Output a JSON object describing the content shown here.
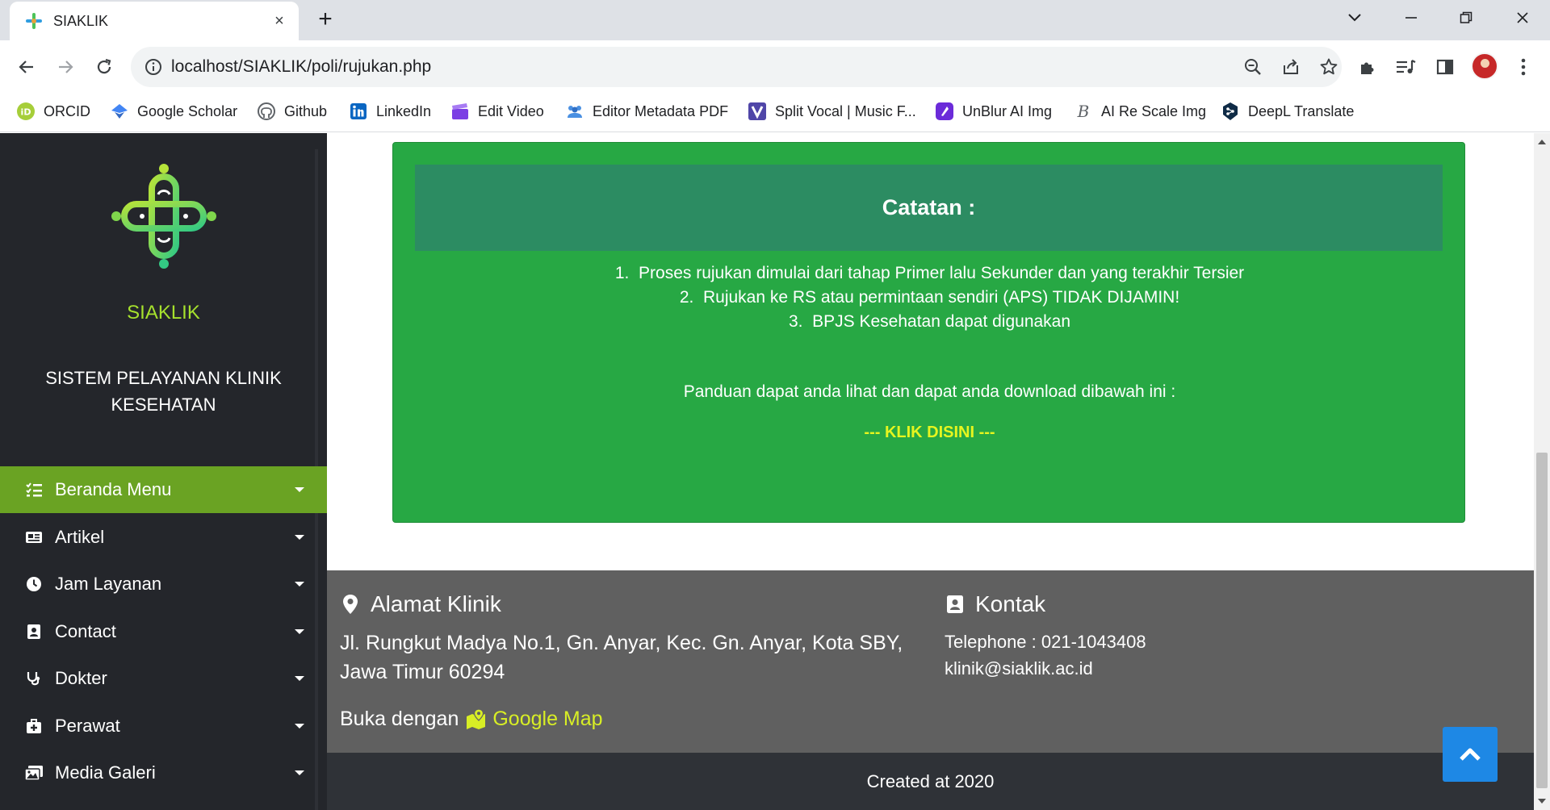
{
  "browser": {
    "tab_title": "SIAKLIK",
    "tab_close": "×",
    "new_tab": "+",
    "url": "localhost/SIAKLIK/poli/rujukan.php",
    "bookmarks": [
      {
        "label": "ORCID",
        "icon": "orcid-icon"
      },
      {
        "label": "Google Scholar",
        "icon": "google-scholar-icon"
      },
      {
        "label": "Github",
        "icon": "github-icon"
      },
      {
        "label": "LinkedIn",
        "icon": "linkedin-icon"
      },
      {
        "label": "Edit Video",
        "icon": "clapperboard-icon"
      },
      {
        "label": "Editor Metadata PDF",
        "icon": "users-icon"
      },
      {
        "label": "Split Vocal | Music F...",
        "icon": "v-logo-icon"
      },
      {
        "label": "UnBlur AI Img",
        "icon": "unblur-icon"
      },
      {
        "label": "AI Re Scale Img",
        "icon": "b-logo-icon"
      },
      {
        "label": "DeepL Translate",
        "icon": "deepl-icon"
      }
    ]
  },
  "sidebar": {
    "brand": "SIAKLIK",
    "subtitle": "SISTEM PELAYANAN KLINIK KESEHATAN",
    "menu": [
      {
        "label": "Beranda Menu",
        "icon": "list-icon",
        "active": true
      },
      {
        "label": "Artikel",
        "icon": "newspaper-icon",
        "active": false
      },
      {
        "label": "Jam Layanan",
        "icon": "clock-icon",
        "active": false
      },
      {
        "label": "Contact",
        "icon": "contact-card-icon",
        "active": false
      },
      {
        "label": "Dokter",
        "icon": "stethoscope-icon",
        "active": false
      },
      {
        "label": "Perawat",
        "icon": "medkit-icon",
        "active": false
      },
      {
        "label": "Media Galeri",
        "icon": "images-icon",
        "active": false
      }
    ]
  },
  "note": {
    "title": "Catatan :",
    "items": [
      "1.  Proses rujukan dimulai dari tahap Primer lalu Sekunder dan yang terakhir Tersier",
      "2.  Rujukan ke RS atau permintaan sendiri (APS) TIDAK DIJAMIN!",
      "3.  BPJS Kesehatan dapat digunakan"
    ],
    "guide": "Panduan dapat anda lihat dan dapat anda download dibawah ini :",
    "link": "--- KLIK DISINI ---"
  },
  "footer": {
    "address_heading": "Alamat Klinik",
    "address_line1": "Jl. Rungkut Madya No.1, Gn. Anyar, Kec. Gn. Anyar, Kota SBY,",
    "address_line2": "Jawa Timur 60294",
    "open_with": "Buka dengan",
    "map_link": "Google Map",
    "contact_heading": "Kontak",
    "telephone": "Telephone : 021-1043408",
    "email": "klinik@siaklik.ac.id",
    "copyright": "Created at 2020"
  },
  "colors": {
    "sidebar_bg": "#24262b",
    "accent_green": "#6aa323",
    "brand_lime": "#a6e12d",
    "card_green": "#27a844",
    "card_header": "#2c8c62",
    "link_yellow": "#e6f51f",
    "footer_bg": "#606060",
    "copyright_bg": "#2f3237",
    "to_top_blue": "#1e88e5"
  }
}
